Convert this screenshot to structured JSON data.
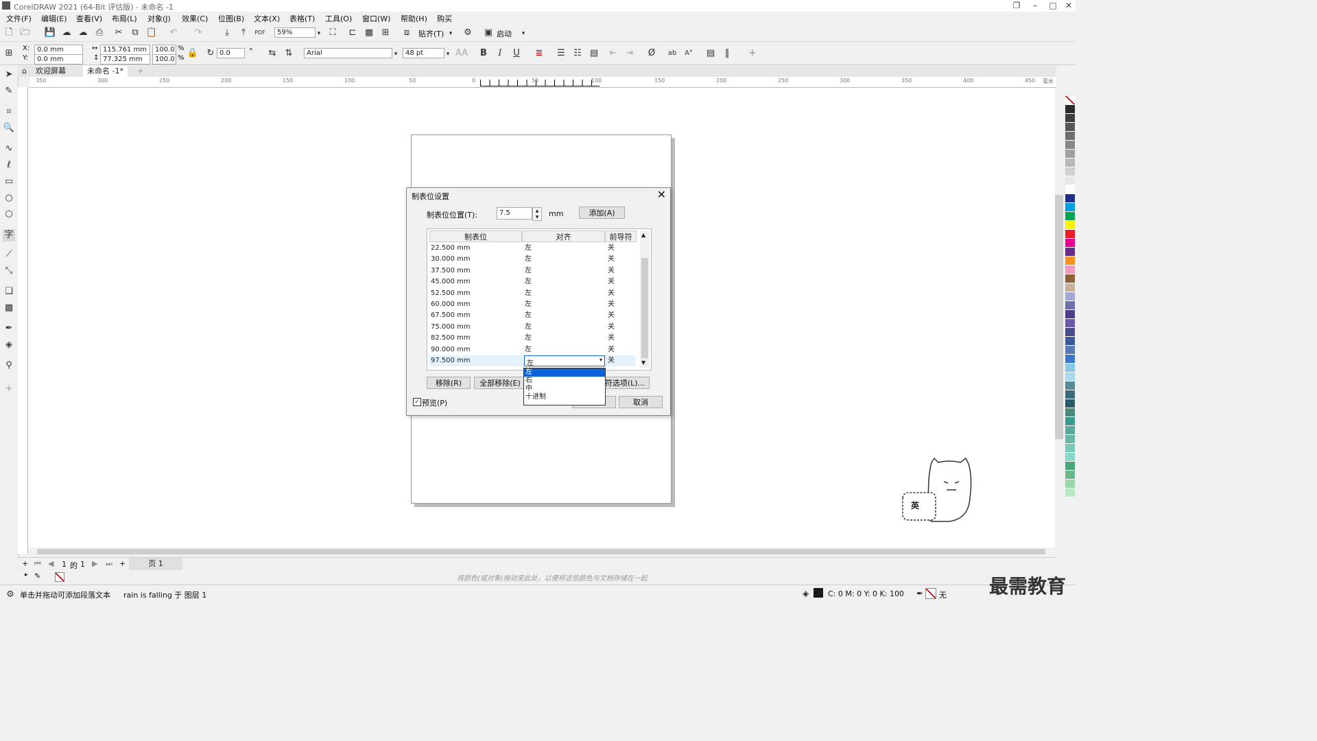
{
  "window": {
    "title": "CorelDRAW 2021 (64-Bit 评估版) - 未命名 -1"
  },
  "menu": [
    "文件(F)",
    "编辑(E)",
    "查看(V)",
    "布局(L)",
    "对象(J)",
    "效果(C)",
    "位图(B)",
    "文本(X)",
    "表格(T)",
    "工具(O)",
    "窗口(W)",
    "帮助(H)",
    "购买"
  ],
  "toolbar": {
    "zoom": "59%",
    "snap_label": "贴齐(T)",
    "launch_label": "启动"
  },
  "propbar": {
    "x_label": "X:",
    "x": "0.0 mm",
    "y_label": "Y:",
    "y": "0.0 mm",
    "width": "115.761 mm",
    "height": "77.325 mm",
    "scale_w": "100.0",
    "scale_h": "100.0",
    "pct": "%",
    "rotation": "0.0",
    "degree": "°",
    "font": "Arial",
    "size": "48 pt",
    "bold": "B",
    "italic": "I",
    "underline": "U"
  },
  "tabs": {
    "welcome": "欢迎屏幕",
    "doc": "未命名 -1*",
    "add": "+"
  },
  "ruler": {
    "h": [
      "350",
      "300",
      "250",
      "200",
      "150",
      "100",
      "50",
      "0",
      "50",
      "100",
      "150",
      "200",
      "250",
      "300",
      "350",
      "400",
      "450"
    ],
    "unit": "毫米"
  },
  "dialog": {
    "title": "制表位设置",
    "pos_label": "制表位位置(T):",
    "pos_value": "7.5",
    "unit": "mm",
    "add_button": "添加(A)",
    "columns": [
      "制表位",
      "对齐",
      "前导符"
    ],
    "rows": [
      {
        "pos": "22.500 mm",
        "align": "左",
        "leader": "关"
      },
      {
        "pos": "30.000 mm",
        "align": "左",
        "leader": "关"
      },
      {
        "pos": "37.500 mm",
        "align": "左",
        "leader": "关"
      },
      {
        "pos": "45.000 mm",
        "align": "左",
        "leader": "关"
      },
      {
        "pos": "52.500 mm",
        "align": "左",
        "leader": "关"
      },
      {
        "pos": "60.000 mm",
        "align": "左",
        "leader": "关"
      },
      {
        "pos": "67.500 mm",
        "align": "左",
        "leader": "关"
      },
      {
        "pos": "75.000 mm",
        "align": "左",
        "leader": "关"
      },
      {
        "pos": "82.500 mm",
        "align": "左",
        "leader": "关"
      },
      {
        "pos": "90.000 mm",
        "align": "左",
        "leader": "关"
      },
      {
        "pos": "97.500 mm",
        "align": "左",
        "leader": "关"
      }
    ],
    "dropdown_options": [
      "左",
      "右",
      "中",
      "十进制"
    ],
    "remove_button": "移除(R)",
    "remove_all_button": "全部移除(E)",
    "leader_options_button": "符选项(L)...",
    "preview_label": "预览(P)",
    "ok_button": "OK",
    "cancel_button": "取消"
  },
  "pagenav": {
    "current": "1",
    "of": "的",
    "total": "1",
    "page_tab": "页 1"
  },
  "colorbar_hint": "将颜色(或对象)拖动至此处，以便将这些颜色与文档存储在一起",
  "status": {
    "hint": "单击并拖动可添加段落文本",
    "object": "rain is falling 于 图层 1",
    "fill": "C: 0 M: 0 Y: 0 K: 100",
    "outline": "无"
  },
  "ime": {
    "label": "英"
  },
  "watermark": "最需教育",
  "colors": {
    "palette": [
      "#2b2b2b",
      "#3d3d3d",
      "#555",
      "#6e6e6e",
      "#888",
      "#a0a0a0",
      "#b8b8b8",
      "#d0d0d0",
      "#e8e8e8",
      "#ffffff",
      "#1f2d8f",
      "#00a0e0",
      "#00a651",
      "#fff200",
      "#ed1c24",
      "#ec008c",
      "#662d91",
      "#f7941d",
      "#f49ac1",
      "#8c6239",
      "#c7b299",
      "#a3a7d6",
      "#6d6fb0",
      "#4e3d8a",
      "#6b5aa8",
      "#4a4a8a",
      "#3a5a9a",
      "#5a7ab8",
      "#3a78c8",
      "#8ac8e8",
      "#a8d8f0",
      "#5a8a9a",
      "#3a6a7a",
      "#2a5a6a",
      "#4a8a7a",
      "#3a9a8a",
      "#5aaa9a",
      "#6ab8a8",
      "#7ac8b8",
      "#8ad8c8",
      "#4aa878",
      "#6ab888",
      "#9ad8a8",
      "#b8e8c0"
    ]
  }
}
